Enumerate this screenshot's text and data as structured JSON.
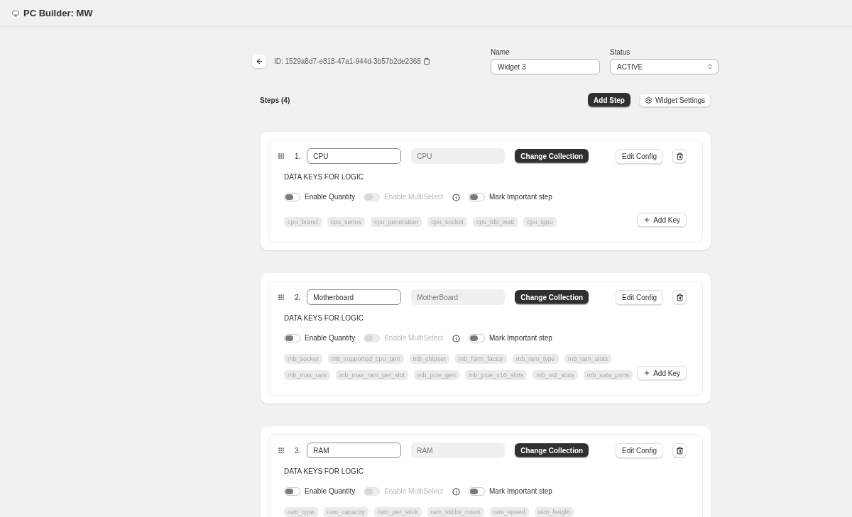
{
  "header": {
    "title": "PC Builder: MW"
  },
  "widget": {
    "id": "ID: 1529a8d7-e818-47a1-944d-3b57b2de2368",
    "name": {
      "label": "Name",
      "value": "Widget 3"
    },
    "status": {
      "label": "Status",
      "value": "ACTIVE"
    }
  },
  "steps_bar": {
    "title": "Steps (4)",
    "buttons": [
      {
        "label": "Add Step",
        "kind": "primary"
      },
      {
        "label": "Widget Settings",
        "kind": "settings"
      }
    ]
  },
  "steps": [
    {
      "number": "1.",
      "name": "CPU",
      "collection": "CPU",
      "change_button": "Change Collection",
      "config_button": "Edit Config",
      "section_title": "DATA KEYS FOR LOGIC",
      "toggles": [
        {
          "label": "Enable Quantity",
          "on": false,
          "disabled": false,
          "info": false
        },
        {
          "label": "Enable MultiSelect",
          "on": false,
          "disabled": true,
          "info": true
        },
        {
          "label": "Mark Important step",
          "on": false,
          "disabled": false,
          "info": false
        }
      ],
      "keys": [
        "cpu_brand",
        "cpu_series",
        "cpu_generation",
        "cpu_socket",
        "cpu_tdp_watt",
        "cpu_igpu"
      ],
      "add_key": "Add Key"
    },
    {
      "number": "2.",
      "name": "Motherboard",
      "collection": "MotherBoard",
      "change_button": "Change Collection",
      "config_button": "Edit Config",
      "section_title": "DATA KEYS FOR LOGIC",
      "toggles": [
        {
          "label": "Enable Quantity",
          "on": false,
          "disabled": false,
          "info": false
        },
        {
          "label": "Enable MultiSelect",
          "on": false,
          "disabled": true,
          "info": true
        },
        {
          "label": "Mark Important step",
          "on": false,
          "disabled": false,
          "info": false
        }
      ],
      "keys": [
        "mb_socket",
        "mb_supported_cpu_gen",
        "mb_chipset",
        "mb_form_factor",
        "mb_ram_type",
        "mb_ram_slots",
        "mb_max_ram",
        "mb_max_ram_per_slot",
        "mb_pcie_gen",
        "mb_pcie_x16_slots",
        "mb_m2_slots",
        "mb_sata_ports"
      ],
      "add_key": "Add Key"
    },
    {
      "number": "3.",
      "name": "RAM",
      "collection": "RAM",
      "change_button": "Change Collection",
      "config_button": "Edit Config",
      "section_title": "DATA KEYS FOR LOGIC",
      "toggles": [
        {
          "label": "Enable Quantity",
          "on": false,
          "disabled": false,
          "info": false
        },
        {
          "label": "Enable MultiSelect",
          "on": false,
          "disabled": true,
          "info": true
        },
        {
          "label": "Mark Important step",
          "on": false,
          "disabled": false,
          "info": false
        }
      ],
      "keys": [
        "ram_type",
        "ram_capacity",
        "ram_per_stick",
        "ram_sticks_count",
        "ram_speed",
        "ram_height"
      ]
    }
  ]
}
